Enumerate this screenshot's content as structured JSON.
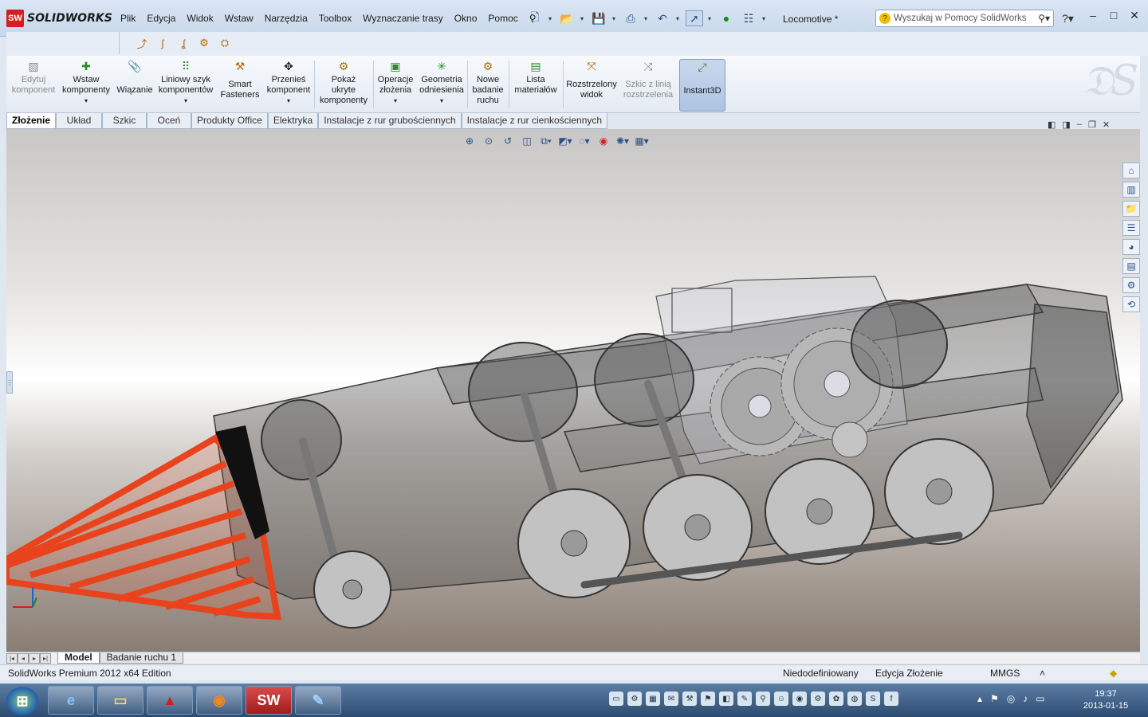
{
  "app": {
    "name": "SOLIDWORKS",
    "logo_badge": "SW",
    "document_title": "Locomotive *"
  },
  "menu": [
    "Plik",
    "Edycja",
    "Widok",
    "Wstaw",
    "Narzędzia",
    "Toolbox",
    "Wyznaczanie trasy",
    "Okno",
    "Pomoc"
  ],
  "search": {
    "placeholder": "Wyszukaj w Pomocy SolidWorks"
  },
  "window_controls": {
    "minimize": "–",
    "maximize": "□",
    "close": "✕"
  },
  "ribbon": [
    {
      "label": "Edytuj komponent",
      "lines": [
        "Edytuj",
        "komponent"
      ],
      "disabled": true,
      "icon": "edit-component-icon"
    },
    {
      "label": "Wstaw komponenty",
      "lines": [
        "Wstaw",
        "komponenty"
      ],
      "icon": "insert-components-icon",
      "dropdown": true
    },
    {
      "label": "Wiązanie",
      "lines": [
        "Wiązanie"
      ],
      "icon": "mate-icon"
    },
    {
      "label": "Liniowy szyk komponentów",
      "lines": [
        "Liniowy szyk",
        "komponentów"
      ],
      "icon": "linear-pattern-icon",
      "dropdown": true
    },
    {
      "label": "Smart Fasteners",
      "lines": [
        "Smart",
        "Fasteners"
      ],
      "icon": "smart-fasteners-icon"
    },
    {
      "label": "Przenieś komponent",
      "lines": [
        "Przenieś",
        "komponent"
      ],
      "icon": "move-component-icon",
      "dropdown": true
    },
    {
      "label": "Pokaż ukryte komponenty",
      "lines": [
        "Pokaż",
        "ukryte",
        "komponenty"
      ],
      "icon": "show-hidden-icon"
    },
    {
      "label": "Operacje złożenia",
      "lines": [
        "Operacje",
        "złożenia"
      ],
      "icon": "assembly-features-icon",
      "dropdown": true
    },
    {
      "label": "Geometria odniesienia",
      "lines": [
        "Geometria",
        "odniesienia"
      ],
      "icon": "reference-geometry-icon",
      "dropdown": true
    },
    {
      "label": "Nowe badanie ruchu",
      "lines": [
        "Nowe",
        "badanie",
        "ruchu"
      ],
      "icon": "motion-study-icon"
    },
    {
      "label": "Lista materiałów",
      "lines": [
        "Lista",
        "materiałów"
      ],
      "icon": "bom-icon"
    },
    {
      "label": "Rozstrzelony widok",
      "lines": [
        "Rozstrzelony",
        "widok"
      ],
      "icon": "exploded-view-icon"
    },
    {
      "label": "Szkic z linią rozstrzelenia",
      "lines": [
        "Szkic z linią",
        "rozstrzelenia"
      ],
      "disabled": true,
      "icon": "explode-line-icon"
    },
    {
      "label": "Instant3D",
      "lines": [
        "Instant3D"
      ],
      "active": true,
      "icon": "instant3d-icon"
    }
  ],
  "tabs": [
    "Złożenie",
    "Układ",
    "Szkic",
    "Oceń",
    "Produkty Office",
    "Elektryka",
    "Instalacje z rur grubościennych",
    "Instalacje z rur cienkościennych"
  ],
  "active_tab": "Złożenie",
  "bottom_tabs": [
    "Model",
    "Badanie ruchu 1"
  ],
  "status": {
    "edition": "SolidWorks Premium 2012 x64 Edition",
    "definition": "Niedodefiniowany",
    "mode": "Edycja Złożenie",
    "units": "MMGS",
    "units_arrow": "˄"
  },
  "taskbar": {
    "start_symbol": "⊞",
    "apps": [
      "IE",
      "Explorer",
      "Acrobat",
      "Firefox",
      "SW",
      "Paint"
    ],
    "time": "19:37",
    "date": "2013-01-15"
  },
  "colors": {
    "accent": "#2b4f86",
    "cowcatcher": "#e8431c",
    "taskbar": "#2c4b72"
  }
}
